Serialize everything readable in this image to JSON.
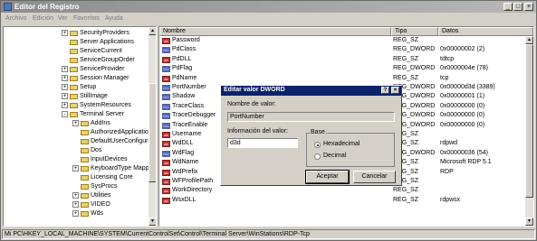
{
  "window": {
    "title": "Editor del Registro",
    "minimize_glyph": "_",
    "maximize_glyph": "□",
    "close_glyph": "×"
  },
  "menu": [
    "Archivo",
    "Edición",
    "Ver",
    "Favoritos",
    "Ayuda"
  ],
  "tree": {
    "items": [
      {
        "label": "SecurityProviders",
        "level": 1,
        "expander": "+"
      },
      {
        "label": "Server Applications",
        "level": 1,
        "expander": ""
      },
      {
        "label": "ServiceCurrent",
        "level": 1,
        "expander": ""
      },
      {
        "label": "ServiceGroupOrder",
        "level": 1,
        "expander": ""
      },
      {
        "label": "ServiceProvider",
        "level": 1,
        "expander": "+"
      },
      {
        "label": "Session Manager",
        "level": 1,
        "expander": "+"
      },
      {
        "label": "Setup",
        "level": 1,
        "expander": "+"
      },
      {
        "label": "StillImage",
        "level": 1,
        "expander": "+"
      },
      {
        "label": "SystemResources",
        "level": 1,
        "expander": "+"
      },
      {
        "label": "Terminal Server",
        "level": 1,
        "expander": "-"
      },
      {
        "label": "AddIns",
        "level": 2,
        "expander": "+"
      },
      {
        "label": "AuthorizedApplicatio",
        "level": 2,
        "expander": ""
      },
      {
        "label": "DefaultUserConfigur",
        "level": 2,
        "expander": ""
      },
      {
        "label": "Dos",
        "level": 2,
        "expander": ""
      },
      {
        "label": "InputDevices",
        "level": 2,
        "expander": ""
      },
      {
        "label": "KeyboardType Mapp",
        "level": 2,
        "expander": "+"
      },
      {
        "label": "Licensing Core",
        "level": 2,
        "expander": ""
      },
      {
        "label": "SysProcs",
        "level": 2,
        "expander": ""
      },
      {
        "label": "Utilities",
        "level": 2,
        "expander": "+"
      },
      {
        "label": "VIDEO",
        "level": 2,
        "expander": "+"
      },
      {
        "label": "Wds",
        "level": 2,
        "expander": "+"
      }
    ]
  },
  "columns": {
    "name": "Nombre",
    "type": "Tipo",
    "data": "Datos"
  },
  "values": [
    {
      "name": "Password",
      "type": "REG_SZ",
      "data": "",
      "icon": "sz"
    },
    {
      "name": "PdClass",
      "type": "REG_DWORD",
      "data": "0x00000002 (2)",
      "icon": "dw"
    },
    {
      "name": "PdDLL",
      "type": "REG_SZ",
      "data": "tdtcp",
      "icon": "sz"
    },
    {
      "name": "PdFlag",
      "type": "REG_DWORD",
      "data": "0x0000004e (78)",
      "icon": "dw"
    },
    {
      "name": "PdName",
      "type": "REG_SZ",
      "data": "tcp",
      "icon": "sz"
    },
    {
      "name": "PortNumber",
      "type": "REG_DWORD",
      "data": "0x00000d3d (3389)",
      "icon": "dw"
    },
    {
      "name": "Shadow",
      "type": "REG_DWORD",
      "data": "0x00000001 (1)",
      "icon": "dw"
    },
    {
      "name": "TraceClass",
      "type": "REG_DWORD",
      "data": "0x00000000 (0)",
      "icon": "dw"
    },
    {
      "name": "TraceDebugger",
      "type": "REG_DWORD",
      "data": "0x00000000 (0)",
      "icon": "dw"
    },
    {
      "name": "TraceEnable",
      "type": "REG_DWORD",
      "data": "0x00000000 (0)",
      "icon": "dw"
    },
    {
      "name": "Username",
      "type": "REG_SZ",
      "data": "",
      "icon": "sz"
    },
    {
      "name": "WdDLL",
      "type": "REG_SZ",
      "data": "rdpwd",
      "icon": "sz"
    },
    {
      "name": "WdFlag",
      "type": "REG_DWORD",
      "data": "0x00000036 (54)",
      "icon": "dw"
    },
    {
      "name": "WdName",
      "type": "REG_SZ",
      "data": "Microsoft RDP 5.1",
      "icon": "sz"
    },
    {
      "name": "WdPrefix",
      "type": "REG_SZ",
      "data": "RDP",
      "icon": "sz"
    },
    {
      "name": "WFProfilePath",
      "type": "REG_SZ",
      "data": "",
      "icon": "sz"
    },
    {
      "name": "WorkDirectory",
      "type": "REG_SZ",
      "data": "",
      "icon": "sz"
    },
    {
      "name": "WsxDLL",
      "type": "REG_SZ",
      "data": "rdpwsx",
      "icon": "sz"
    }
  ],
  "status_path": "Mi PC\\HKEY_LOCAL_MACHINE\\SYSTEM\\CurrentControlSet\\Control\\Terminal Server\\WinStations\\RDP-Tcp",
  "dialog": {
    "title": "Editar valor DWORD",
    "help_glyph": "?",
    "close_glyph": "×",
    "name_label": "Nombre de valor:",
    "name_value": "PortNumber",
    "data_label": "Información del valor:",
    "data_value": "d3d",
    "base_label": "Base",
    "hex_label": "Hexadecimal",
    "dec_label": "Decimal",
    "selected_base": "hex",
    "ok_label": "Aceptar",
    "cancel_label": "Cancelar"
  },
  "icons": {
    "sz_icon_text": "ab",
    "dw_icon_text": "011"
  }
}
